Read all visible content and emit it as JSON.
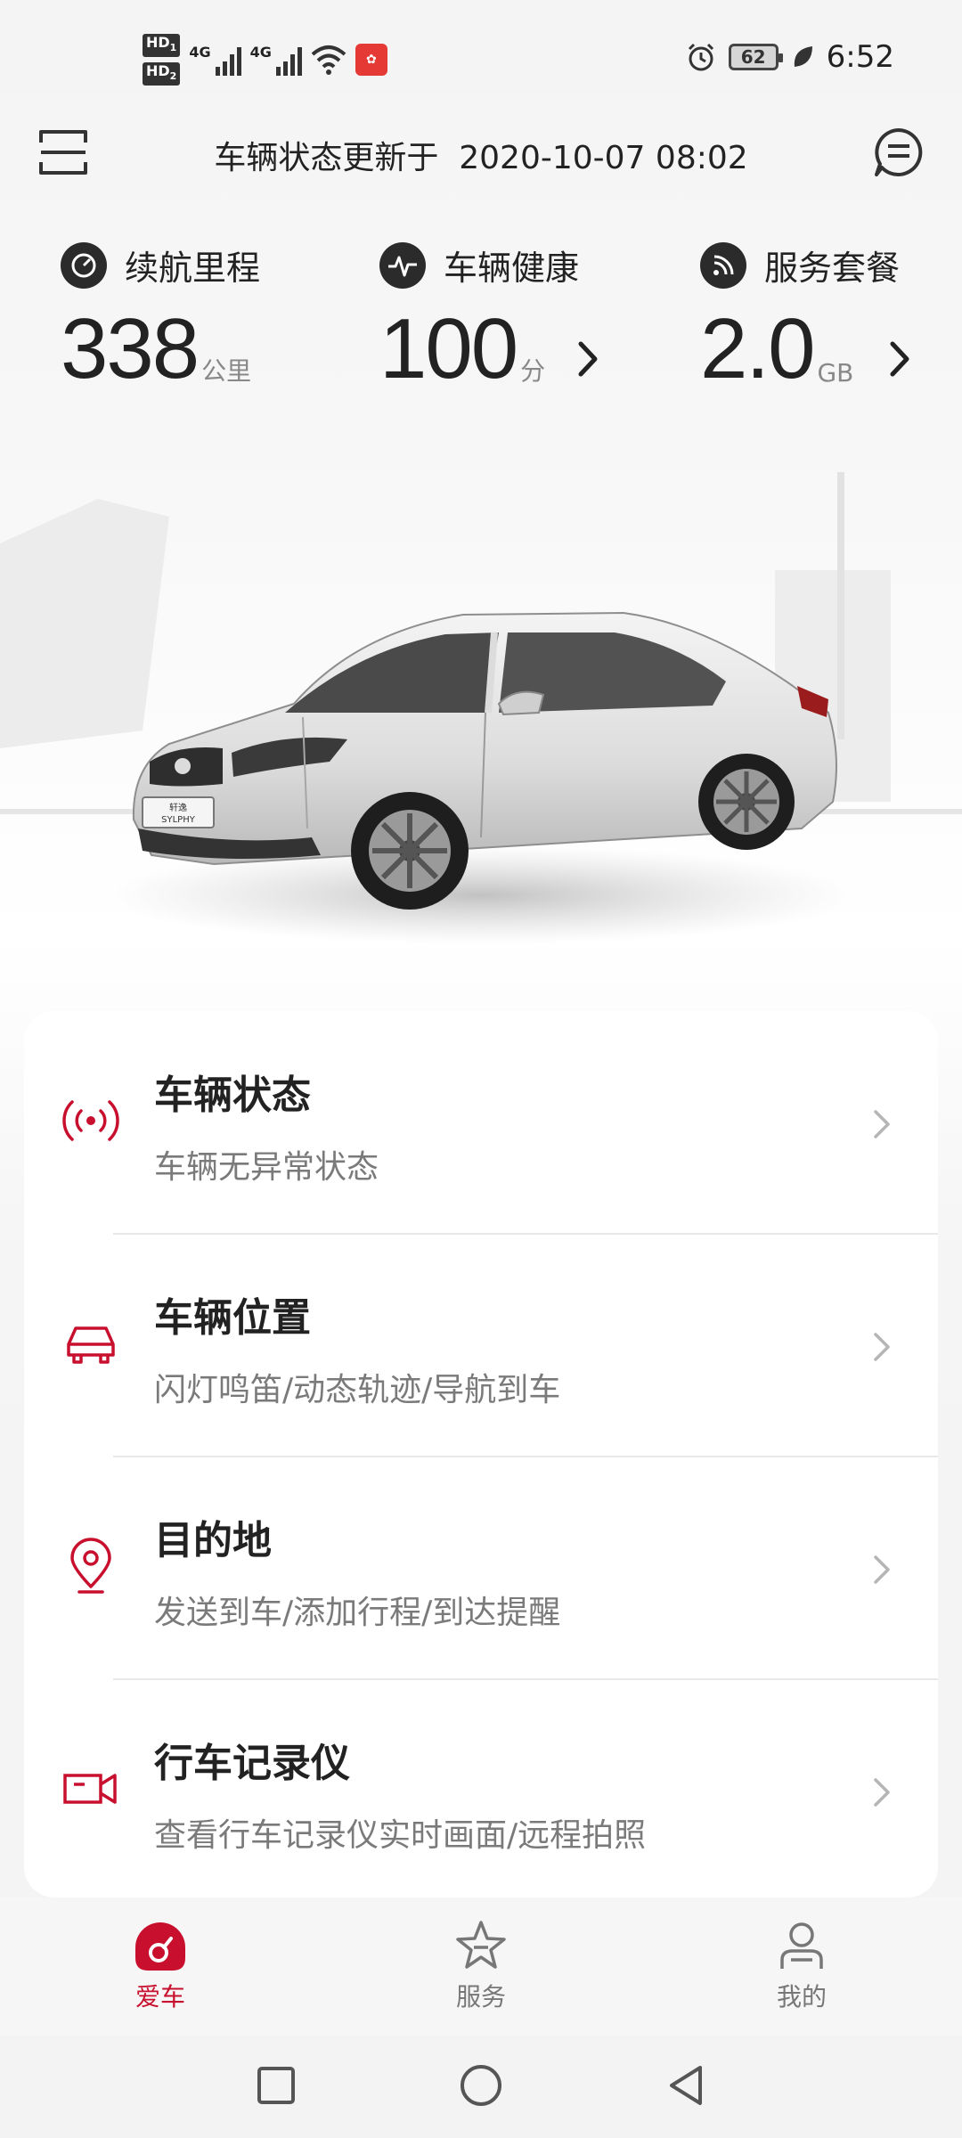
{
  "status_bar": {
    "sim1": "HD",
    "sim1_index": "1",
    "sim2": "HD",
    "sim2_index": "2",
    "net1": "4G",
    "net2": "4G",
    "battery": "62",
    "time": "6:52"
  },
  "header": {
    "update_label": "车辆状态更新于",
    "update_time": "2020-10-07 08:02"
  },
  "stats": [
    {
      "label": "续航里程",
      "value": "338",
      "unit": "公里"
    },
    {
      "label": "车辆健康",
      "value": "100",
      "unit": "分"
    },
    {
      "label": "服务套餐",
      "value": "2.0",
      "unit": "GB"
    }
  ],
  "car": {
    "plate_text": "SYLPHY",
    "plate_sub": "轩逸"
  },
  "menu": [
    {
      "title": "车辆状态",
      "subtitle": "车辆无异常状态",
      "icon": "signal-broadcast-icon"
    },
    {
      "title": "车辆位置",
      "subtitle": "闪灯鸣笛/动态轨迹/导航到车",
      "icon": "car-icon"
    },
    {
      "title": "目的地",
      "subtitle": "发送到车/添加行程/到达提醒",
      "icon": "location-pin-icon"
    },
    {
      "title": "行车记录仪",
      "subtitle": "查看行车记录仪实时画面/远程拍照",
      "icon": "video-camera-icon"
    }
  ],
  "bottom_nav": [
    {
      "label": "爱车",
      "icon": "my-car-icon",
      "active": true
    },
    {
      "label": "服务",
      "icon": "star-icon",
      "active": false
    },
    {
      "label": "我的",
      "icon": "profile-icon",
      "active": false
    }
  ],
  "colors": {
    "accent": "#c8102e",
    "text": "#222222",
    "subtext": "#7a7a7a"
  }
}
